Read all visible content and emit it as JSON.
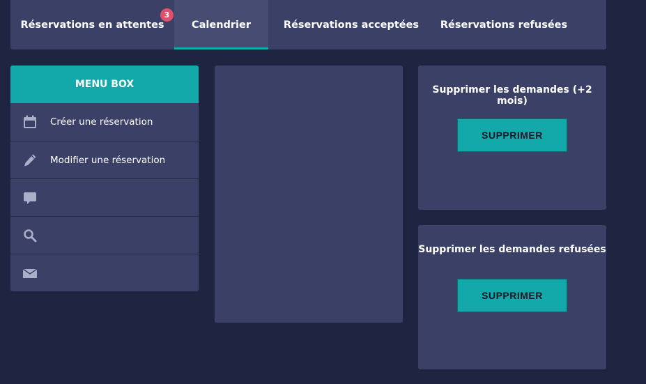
{
  "tabs": [
    {
      "label": "Réservations en attentes",
      "badge": "3"
    },
    {
      "label": "Calendrier",
      "active": true
    },
    {
      "label": "Réservations acceptées"
    },
    {
      "label": "Réservations refusées"
    }
  ],
  "menu": {
    "header": "MENU BOX",
    "items": [
      {
        "icon": "calendar-icon",
        "label": "Créer une réservation"
      },
      {
        "icon": "pencil-icon",
        "label": "Modifier une réservation"
      },
      {
        "icon": "chat-icon",
        "label": ""
      },
      {
        "icon": "search-icon",
        "label": ""
      },
      {
        "icon": "mail-icon",
        "label": ""
      }
    ]
  },
  "cards": [
    {
      "title": "Supprimer les demandes (+2 mois)",
      "button": "SUPPRIMER"
    },
    {
      "title": "Supprimer les demandes refusées",
      "button": "SUPPRIMER"
    }
  ],
  "colors": {
    "background": "#1f2540",
    "panel": "#3a4066",
    "accent": "#13a8a9",
    "badge": "#e0506a",
    "icon": "#aab0c8"
  }
}
